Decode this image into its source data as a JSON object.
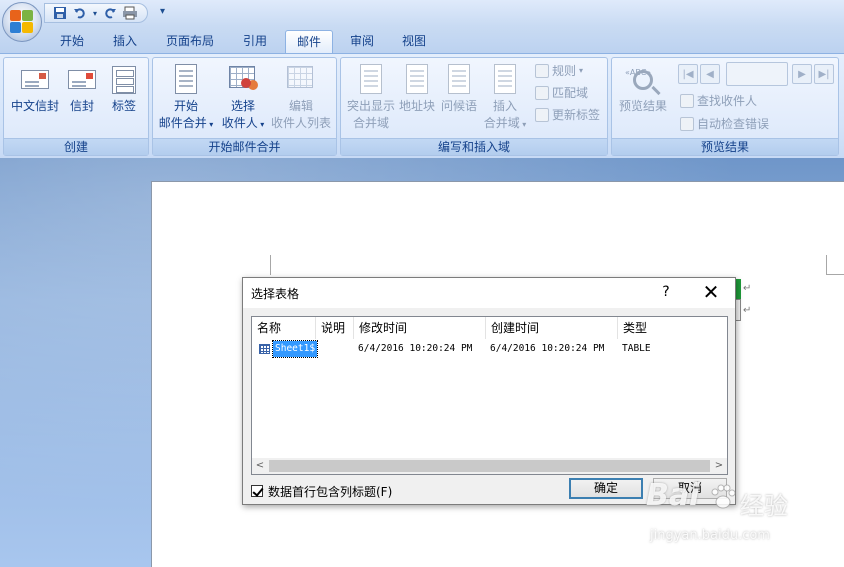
{
  "qat": {
    "icons": [
      "save-icon",
      "undo-icon",
      "redo-icon",
      "print-preview-icon"
    ],
    "more": "▾"
  },
  "tabs": [
    {
      "label": "开始",
      "active": false
    },
    {
      "label": "插入",
      "active": false
    },
    {
      "label": "页面布局",
      "active": false
    },
    {
      "label": "引用",
      "active": false
    },
    {
      "label": "邮件",
      "active": true
    },
    {
      "label": "审阅",
      "active": false
    },
    {
      "label": "视图",
      "active": false
    }
  ],
  "ribbon": {
    "create": {
      "label": "创建",
      "envelopes": "中文信封",
      "envelope": "信封",
      "labels": "标签"
    },
    "start_merge": {
      "label": "开始邮件合并",
      "start_line1": "开始",
      "start_line2": "邮件合并",
      "select_line1": "选择",
      "select_line2": "收件人",
      "edit_line1": "编辑",
      "edit_line2": "收件人列表"
    },
    "write_insert": {
      "label": "编写和插入域",
      "highlight_line1": "突出显示",
      "highlight_line2": "合并域",
      "address_block": "地址块",
      "greeting": "问候语",
      "insert_line1": "插入",
      "insert_line2": "合并域",
      "rules": "规则",
      "match_fields": "匹配域",
      "update_labels": "更新标签"
    },
    "preview": {
      "label": "预览结果",
      "preview_results": "预览结果",
      "abc_badge": "«ABC»",
      "find_recipient": "查找收件人",
      "auto_check": "自动检查错误"
    }
  },
  "dialog": {
    "title": "选择表格",
    "help": "?",
    "close": "✕",
    "columns": [
      "名称",
      "说明",
      "修改时间",
      "创建时间",
      "类型"
    ],
    "rows": [
      {
        "name": "Sheet1$",
        "description": "",
        "modified": "6/4/2016 10:20:24 PM",
        "created": "6/4/2016 10:20:24 PM",
        "type": "TABLE"
      }
    ],
    "scroll_left": "<",
    "scroll_right": ">",
    "checkbox_label": "数据首行包含列标题(F)",
    "checkbox_checked": true,
    "ok": "确定",
    "cancel": "取消"
  },
  "document": {
    "para_mark": "↵"
  },
  "watermark": {
    "brand": "Bai",
    "brand_cn": "经验",
    "url": "jingyan.baidu.com"
  }
}
